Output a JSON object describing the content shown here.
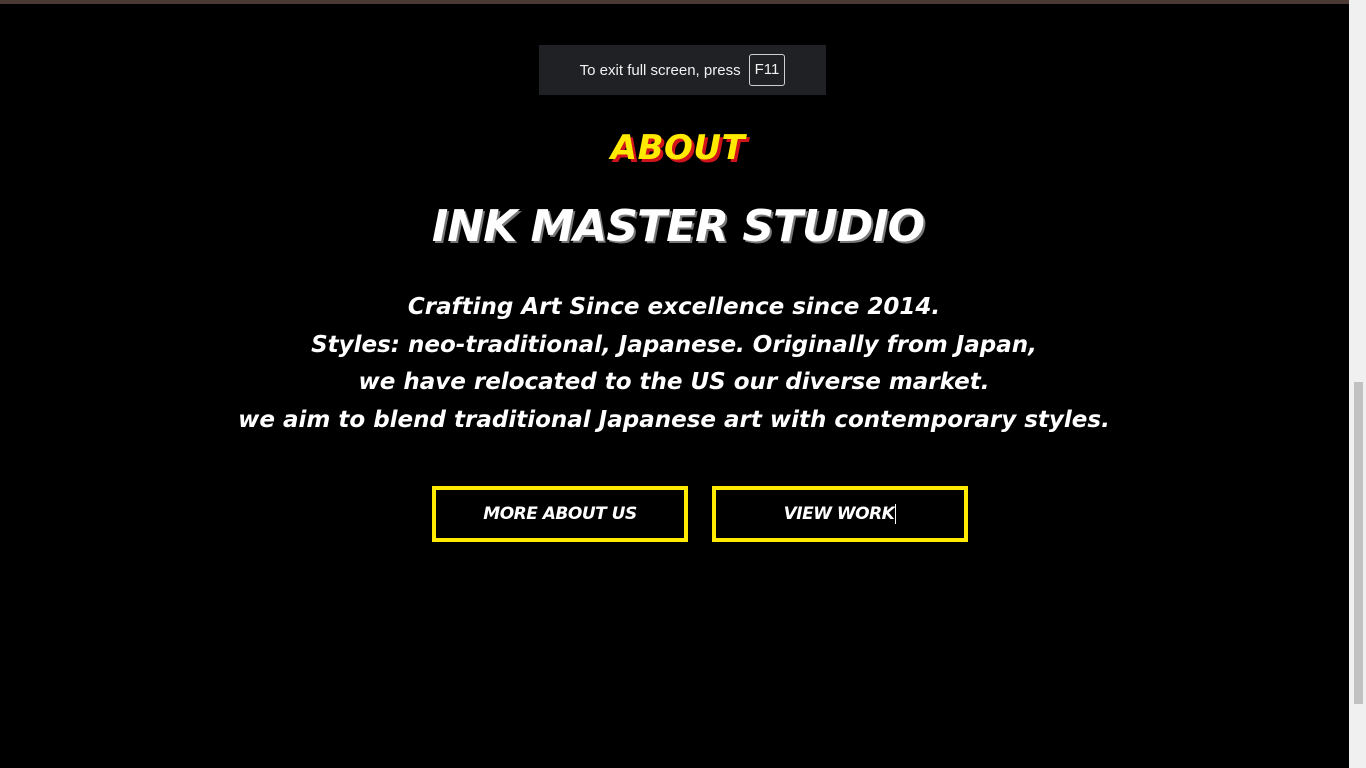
{
  "fullscreen_toast": {
    "message": "To exit full screen, press",
    "key": "F11"
  },
  "about": {
    "section_label": "ABOUT",
    "studio_name": "INK MASTER STUDIO",
    "description_lines": [
      "Crafting Art Since excellence since 2014.",
      "Styles: neo-traditional, Japanese. Originally from Japan,",
      "we have relocated to the US our diverse market.",
      "we aim to blend traditional Japanese art with contemporary styles."
    ],
    "buttons": {
      "more_about_label": "MORE ABOUT US",
      "view_work_label": "VIEW WORK"
    }
  },
  "colors": {
    "background": "#000000",
    "accent_yellow": "#ffea00",
    "accent_red": "#d1141c",
    "text": "#ffffff"
  }
}
